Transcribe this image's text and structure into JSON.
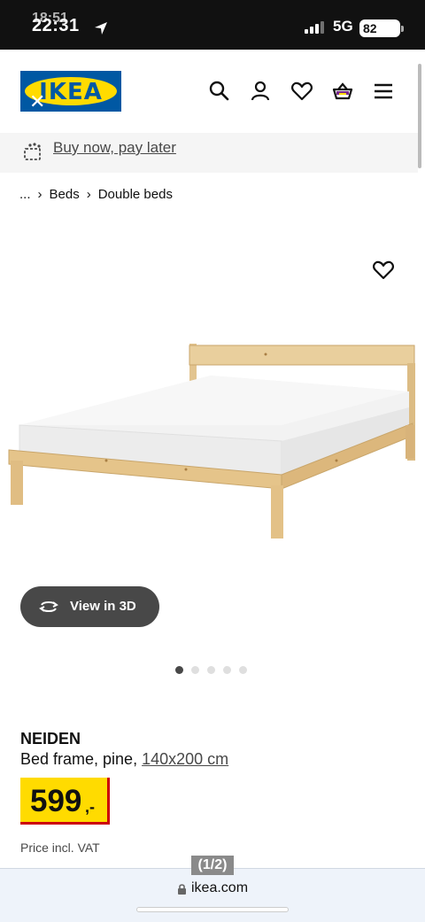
{
  "status_bar": {
    "time": "22:31",
    "time_ghost": "18:51",
    "network": "5G",
    "battery": "82"
  },
  "header": {
    "logo_text": "IKEA",
    "icons": [
      "search-icon",
      "account-icon",
      "heart-icon",
      "basket-icon",
      "menu-icon"
    ]
  },
  "promo": {
    "label": "Buy now, pay later"
  },
  "breadcrumb": {
    "ellipsis": "...",
    "items": [
      "Beds",
      "Double beds"
    ]
  },
  "gallery": {
    "view3d_label": "View in 3D",
    "total_images": 5,
    "active_index": 0
  },
  "product": {
    "name": "NEIDEN",
    "description": "Bed frame, pine,",
    "size": "140x200 cm",
    "price": "599",
    "price_suffix": ",-",
    "vat_note": "Price incl. VAT"
  },
  "browser": {
    "page_indicator": "(1/2)",
    "url": "ikea.com"
  },
  "colors": {
    "brand_blue": "#0058a3",
    "brand_yellow": "#ffdb00",
    "price_red": "#cc0008",
    "basket_accent": "#7a2a8e"
  }
}
